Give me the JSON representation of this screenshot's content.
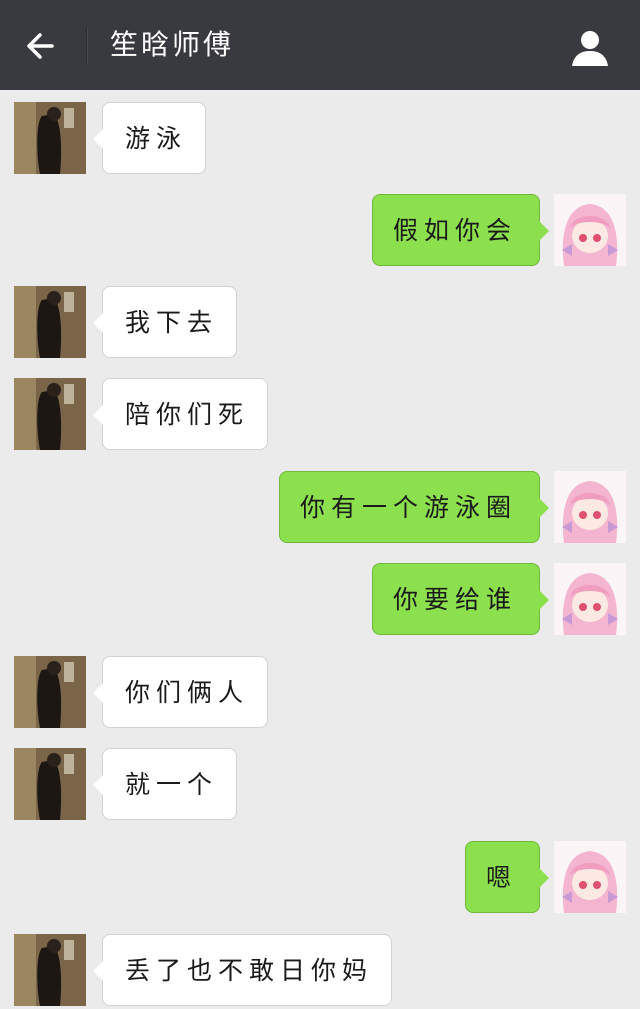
{
  "header": {
    "title": "笙晗师傅",
    "back_icon": "arrow-left-icon",
    "profile_icon": "person-icon",
    "background": "#393a3f"
  },
  "colors": {
    "chat_background": "#ebebeb",
    "incoming_bubble": "#ffffff",
    "outgoing_bubble": "#8ce04e"
  },
  "messages": [
    {
      "direction": "in",
      "text": "游泳"
    },
    {
      "direction": "out",
      "text": "假如你会"
    },
    {
      "direction": "in",
      "text": "我下去"
    },
    {
      "direction": "in",
      "text": "陪你们死"
    },
    {
      "direction": "out",
      "text": "你有一个游泳圈"
    },
    {
      "direction": "out",
      "text": "你要给谁"
    },
    {
      "direction": "in",
      "text": "你们俩人"
    },
    {
      "direction": "in",
      "text": "就一个"
    },
    {
      "direction": "out",
      "text": "嗯"
    },
    {
      "direction": "in",
      "text": "丢了也不敢日你妈"
    }
  ]
}
